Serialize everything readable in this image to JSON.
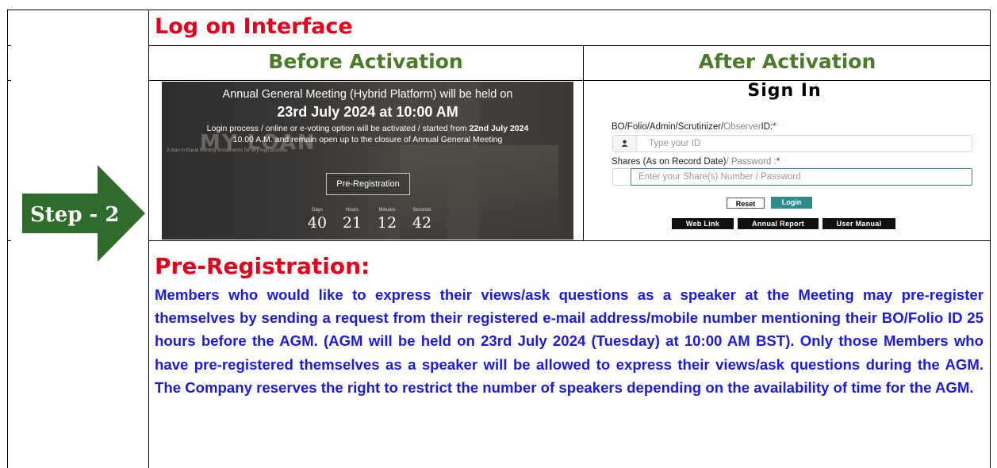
{
  "step": {
    "label": "Step - 2"
  },
  "section1": {
    "title": "Log on Interface"
  },
  "columns": {
    "before": "Before Activation",
    "after": "After Activation"
  },
  "before_panel": {
    "background_word": "MY LOAN",
    "line1": "Annual General Meeting (Hybrid Platform) will be held on",
    "line2": "23rd July 2024 at 10:00 AM",
    "line3_a": "Login process / online or e-voting option will be activated / started from ",
    "line3_b": "22nd July 2024",
    "line4": "10.00 A.M. and remain open up to the closure of Annual General Meeting",
    "line5": "A loan in Equal Monthly Installments for any legit purpose",
    "button": "Pre-Registration",
    "countdown": [
      {
        "label": "Days",
        "value": "40"
      },
      {
        "label": "Hours",
        "value": "21"
      },
      {
        "label": "Minutes",
        "value": "12"
      },
      {
        "label": "Seconds",
        "value": "42"
      }
    ]
  },
  "after_panel": {
    "title": "Sign In",
    "id_label_a": "BO/Folio/Admin/Scrutinizer/",
    "id_label_b": "Observer",
    "id_label_c": "ID:",
    "id_placeholder": "Type your ID",
    "pw_label_a": "Shares (As on Record Date)",
    "pw_label_b": "/ Password :",
    "pw_placeholder": "Enter your Share(s) Number / Password",
    "required_mark": "*",
    "reset": "Reset",
    "login": "Login",
    "links": [
      "Web Link",
      "Annual Report",
      "User Manual"
    ]
  },
  "section2": {
    "title": "Pre-Registration:",
    "body": "Members who would like to express their views/ask questions as a speaker at the Meeting may pre-register themselves by sending a request from their registered e-mail address/mobile number mentioning their BO/Folio ID 25 hours before the AGM. (AGM will be held on 23rd July 2024 (Tuesday) at 10:00 AM BST). Only those Members who have pre-registered themselves as a speaker will be allowed to express their views/ask questions during the AGM. The Company reserves the right to restrict the number of speakers depending on the availability of time for the AGM."
  },
  "colors": {
    "step_green": "#2f6b2b",
    "heading_red": "#e8001a",
    "column_green": "#4a7a2a",
    "body_blue": "#1a1ae6",
    "login_teal": "#2e8b8b"
  }
}
